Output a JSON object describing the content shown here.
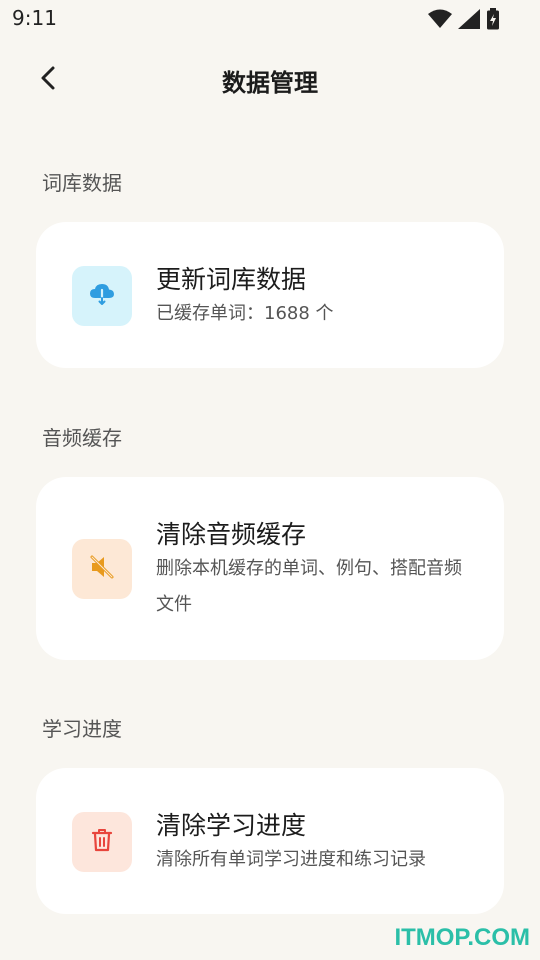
{
  "status_bar": {
    "time": "9:11",
    "icons": [
      "wifi-icon",
      "signal-icon",
      "battery-charging-icon"
    ]
  },
  "header": {
    "title": "数据管理",
    "back_icon": "chevron-left-icon"
  },
  "sections": [
    {
      "title": "词库数据",
      "card": {
        "icon": "cloud-download-icon",
        "icon_color": "#2f9de0",
        "icon_bg": "#d6f3fb",
        "title": "更新词库数据",
        "desc": "已缓存单词：1688 个"
      }
    },
    {
      "title": "音频缓存",
      "card": {
        "icon": "speaker-muted-icon",
        "icon_color": "#e89a1e",
        "icon_bg": "#fde8d6",
        "title": "清除音频缓存",
        "desc": "删除本机缓存的单词、例句、搭配音频文件"
      }
    },
    {
      "title": "学习进度",
      "card": {
        "icon": "trash-icon",
        "icon_color": "#e8453c",
        "icon_bg": "#fde6dc",
        "title": "清除学习进度",
        "desc": "清除所有单词学习进度和练习记录"
      }
    }
  ],
  "watermark": "ITMOP.COM"
}
